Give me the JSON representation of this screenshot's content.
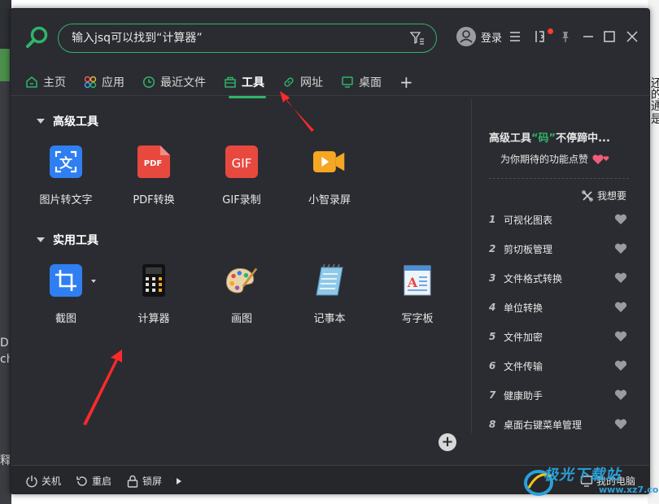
{
  "search": {
    "placeholder": "输入jsq可以找到“计算器”"
  },
  "user": {
    "login_label": "登录"
  },
  "nav": {
    "items": [
      {
        "label": "主页",
        "icon": "home-icon"
      },
      {
        "label": "应用",
        "icon": "apps-icon"
      },
      {
        "label": "最近文件",
        "icon": "clock-icon"
      },
      {
        "label": "工具",
        "icon": "toolbox-icon",
        "active": true
      },
      {
        "label": "网址",
        "icon": "link-icon"
      },
      {
        "label": "桌面",
        "icon": "monitor-icon"
      }
    ],
    "plus": "+"
  },
  "advanced": {
    "title": "高级工具",
    "tools": [
      {
        "label": "图片转文字",
        "icon": "image-to-text-icon"
      },
      {
        "label": "PDF转换",
        "icon": "pdf-icon",
        "icon_text": "PDF"
      },
      {
        "label": "GIF录制",
        "icon": "gif-icon",
        "icon_text": "GIF"
      },
      {
        "label": "小智录屏",
        "icon": "screen-record-icon"
      }
    ]
  },
  "practical": {
    "title": "实用工具",
    "tools": [
      {
        "label": "截图",
        "icon": "crop-icon"
      },
      {
        "label": "计算器",
        "icon": "calculator-icon"
      },
      {
        "label": "画图",
        "icon": "palette-icon"
      },
      {
        "label": "记事本",
        "icon": "notepad-icon"
      },
      {
        "label": "写字板",
        "icon": "wordpad-icon",
        "icon_text": "A"
      }
    ]
  },
  "panel": {
    "title_pre": "高级工具",
    "title_hl": "“码”",
    "title_post": "不停蹄中...",
    "subtitle": "为你期待的功能点赞",
    "want_label": "我想要",
    "wishes": [
      {
        "num": "1",
        "name": "可视化图表"
      },
      {
        "num": "2",
        "name": "剪切板管理"
      },
      {
        "num": "3",
        "name": "文件格式转换"
      },
      {
        "num": "4",
        "name": "单位转换"
      },
      {
        "num": "5",
        "name": "文件加密"
      },
      {
        "num": "6",
        "name": "文件传输"
      },
      {
        "num": "7",
        "name": "健康助手"
      },
      {
        "num": "8",
        "name": "桌面右键菜单管理"
      }
    ]
  },
  "footer": {
    "shutdown": "关机",
    "restart": "重启",
    "lock": "锁屏",
    "my_computer": "我的电脑"
  },
  "watermark": {
    "text": "极光下载站",
    "url": "www.xz7.com"
  },
  "background": {
    "right_text": [
      "还",
      "的",
      "通",
      "是"
    ],
    "left_text": [
      "Di",
      "ch",
      "释"
    ]
  },
  "colors": {
    "accent": "#2fb569",
    "window_bg": "#2b2c31",
    "arrow": "#ff2a2a"
  }
}
